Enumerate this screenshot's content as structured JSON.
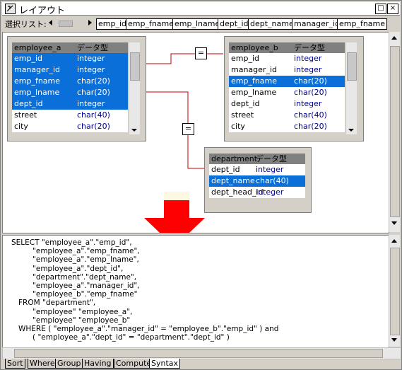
{
  "window": {
    "title": "レイアウト",
    "buttons": {
      "restore": "□",
      "close": "×"
    }
  },
  "selection_list": {
    "label": "選択リスト:",
    "items": [
      "emp_id",
      "emp_fname",
      "emp_lname",
      "dept_id",
      "dept_name",
      "manager_id",
      "emp_fname"
    ]
  },
  "tables": [
    {
      "name": "employee_a",
      "type_header": "データ型",
      "rows": [
        {
          "col": "emp_id",
          "type": "integer",
          "selected": true
        },
        {
          "col": "manager_id",
          "type": "integer",
          "selected": true
        },
        {
          "col": "emp_fname",
          "type": "char(20)",
          "selected": true
        },
        {
          "col": "emp_lname",
          "type": "char(20)",
          "selected": true
        },
        {
          "col": "dept_id",
          "type": "integer",
          "selected": true
        },
        {
          "col": "street",
          "type": "char(40)",
          "selected": false
        },
        {
          "col": "city",
          "type": "char(20)",
          "selected": false
        }
      ]
    },
    {
      "name": "employee_b",
      "type_header": "データ型",
      "rows": [
        {
          "col": "emp_id",
          "type": "integer",
          "selected": false
        },
        {
          "col": "manager_id",
          "type": "integer",
          "selected": false
        },
        {
          "col": "emp_fname",
          "type": "char(20)",
          "selected": true
        },
        {
          "col": "emp_lname",
          "type": "char(20)",
          "selected": false
        },
        {
          "col": "dept_id",
          "type": "integer",
          "selected": false
        },
        {
          "col": "street",
          "type": "char(40)",
          "selected": false
        },
        {
          "col": "city",
          "type": "char(20)",
          "selected": false
        }
      ]
    },
    {
      "name": "department",
      "type_header": "データ型",
      "rows": [
        {
          "col": "dept_id",
          "type": "integer",
          "selected": false
        },
        {
          "col": "dept_name",
          "type": "char(40)",
          "selected": true
        },
        {
          "col": "dept_head_id",
          "type": "integer",
          "selected": false
        }
      ]
    }
  ],
  "joins": [
    {
      "op": "="
    },
    {
      "op": "="
    }
  ],
  "colors": {
    "selection": "#0a6fd8",
    "type_text": "#00008b",
    "join_line": "#c00000",
    "arrow": "#ff0000"
  },
  "sql": "SELECT \"employee_a\".\"emp_id\",\n         \"employee_a\".\"emp_fname\",\n         \"employee_a\".\"emp_lname\",\n         \"employee_a\".\"dept_id\",\n         \"department\".\"dept_name\",\n         \"employee_a\".\"manager_id\",\n         \"employee_b\".\"emp_fname\"\n   FROM \"department\",\n         \"employee\" \"employee_a\",\n         \"employee\" \"employee_b\"\n   WHERE ( \"employee_a\".\"manager_id\" = \"employee_b\".\"emp_id\" ) and\n         ( \"employee_a\".\"dept_id\" = \"department\".\"dept_id\" )",
  "tabs": [
    "Sort",
    "Where",
    "Group",
    "Having",
    "Compute",
    "Syntax"
  ],
  "active_tab": "Syntax"
}
